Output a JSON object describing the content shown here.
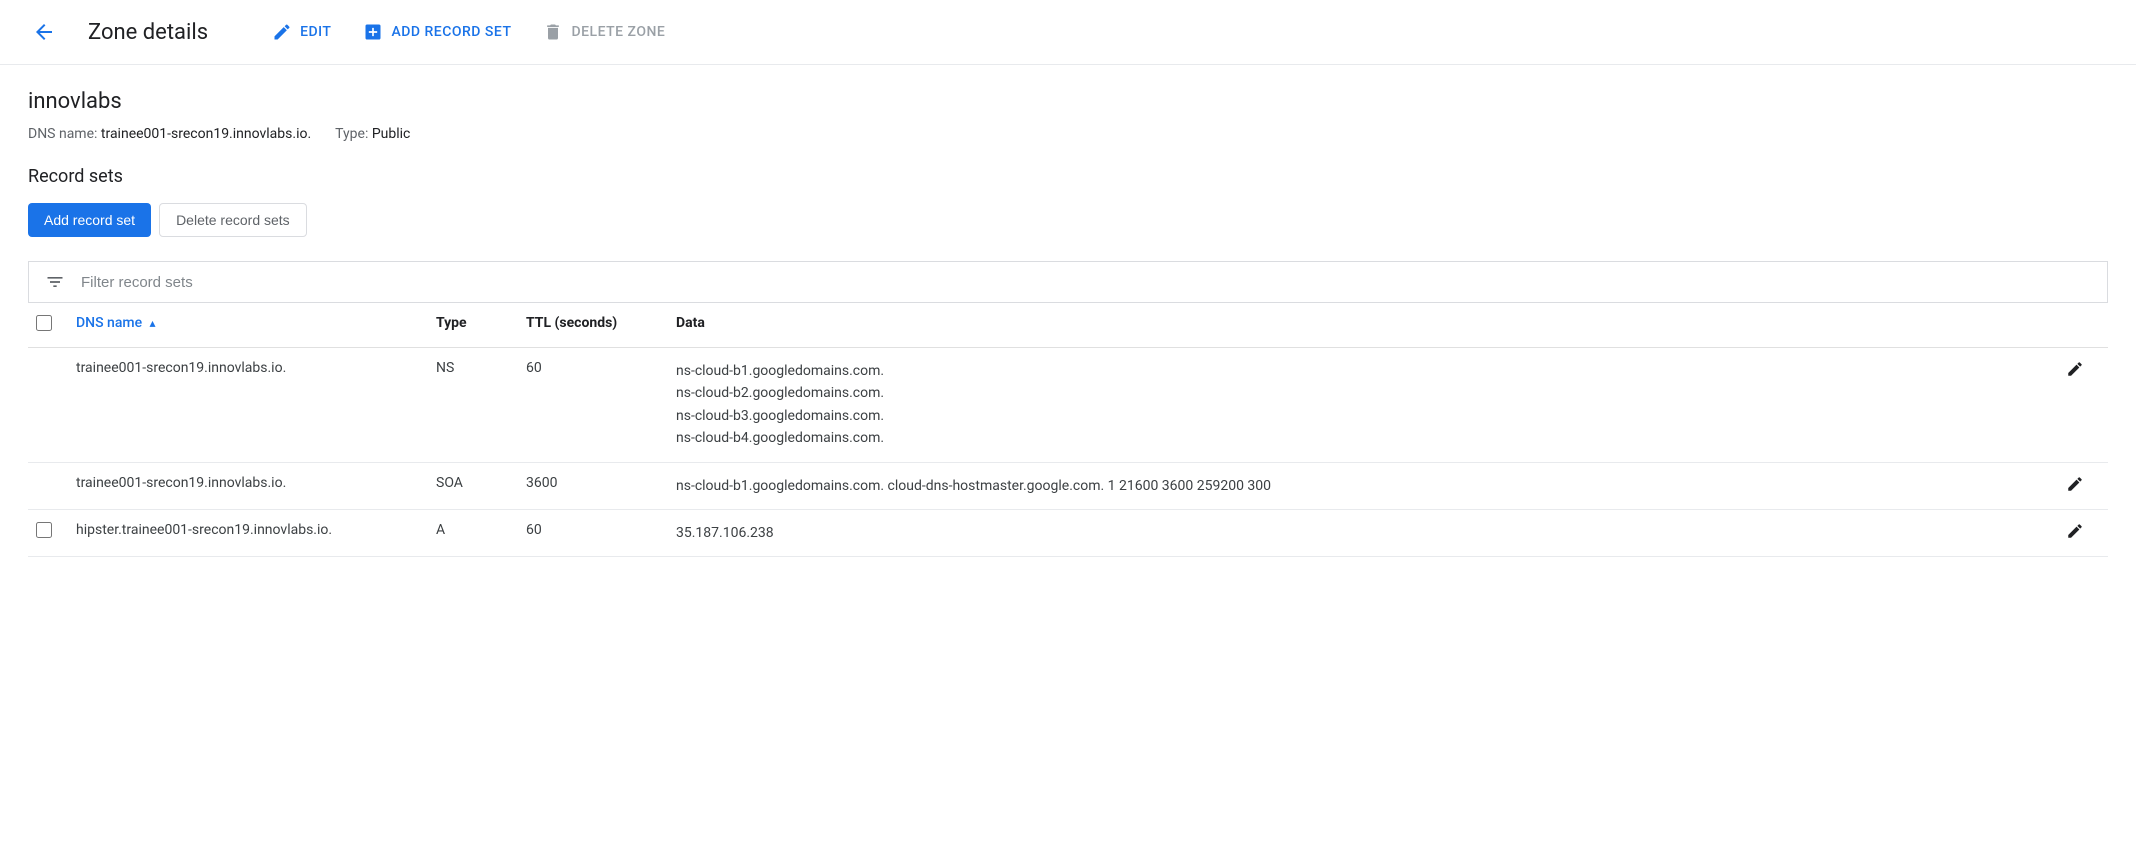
{
  "header": {
    "title": "Zone details",
    "edit_label": "EDIT",
    "add_record_set_label": "ADD RECORD SET",
    "delete_zone_label": "DELETE ZONE"
  },
  "zone": {
    "name": "innovlabs",
    "dns_name_label": "DNS name:",
    "dns_name_value": "trainee001-srecon19.innovlabs.io.",
    "type_label": "Type:",
    "type_value": "Public"
  },
  "record_sets": {
    "section_title": "Record sets",
    "add_button": "Add record set",
    "delete_button": "Delete record sets",
    "filter_placeholder": "Filter record sets",
    "columns": {
      "dns_name": "DNS name",
      "type": "Type",
      "ttl": "TTL (seconds)",
      "data": "Data"
    },
    "rows": [
      {
        "checked": false,
        "show_checkbox": false,
        "name": "trainee001-srecon19.innovlabs.io.",
        "type": "NS",
        "ttl": "60",
        "data": [
          "ns-cloud-b1.googledomains.com.",
          "ns-cloud-b2.googledomains.com.",
          "ns-cloud-b3.googledomains.com.",
          "ns-cloud-b4.googledomains.com."
        ]
      },
      {
        "checked": false,
        "show_checkbox": false,
        "name": "trainee001-srecon19.innovlabs.io.",
        "type": "SOA",
        "ttl": "3600",
        "data": [
          "ns-cloud-b1.googledomains.com. cloud-dns-hostmaster.google.com. 1 21600 3600 259200 300"
        ]
      },
      {
        "checked": false,
        "show_checkbox": true,
        "name": "hipster.trainee001-srecon19.innovlabs.io.",
        "type": "A",
        "ttl": "60",
        "data": [
          "35.187.106.238"
        ]
      }
    ]
  }
}
